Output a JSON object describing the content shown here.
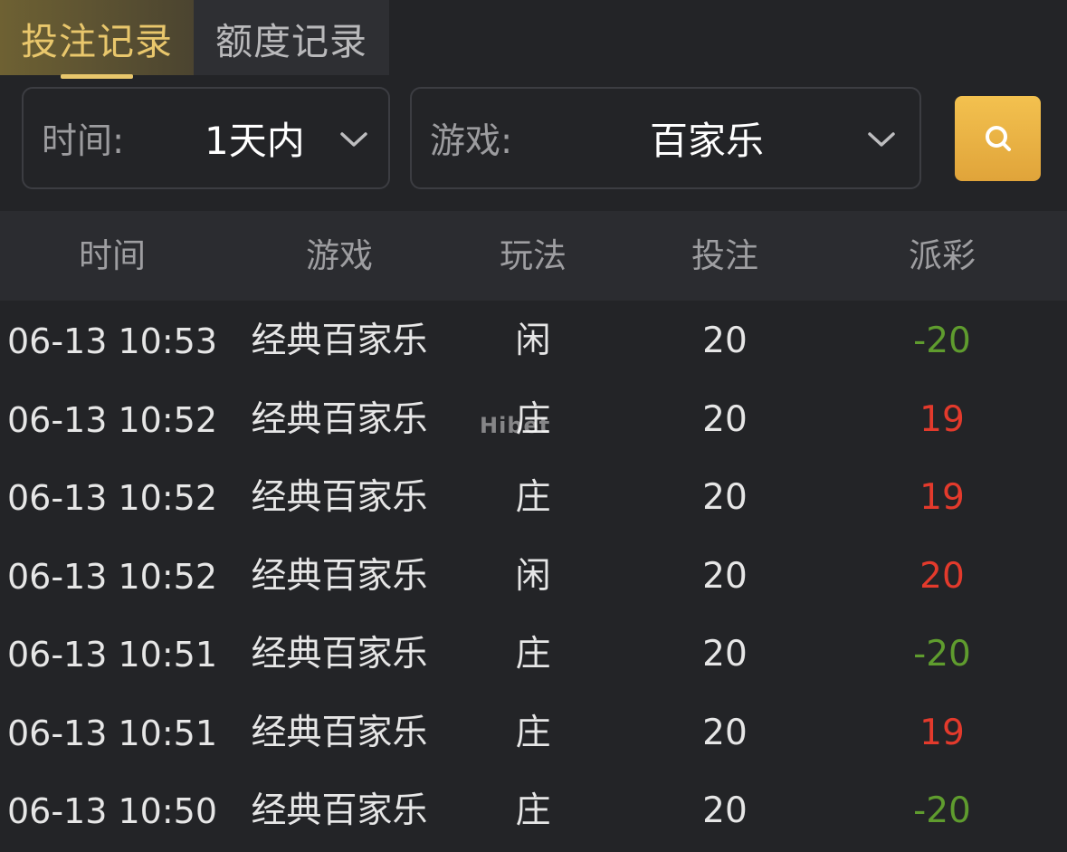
{
  "tabs": [
    {
      "label": "投注记录",
      "active": true
    },
    {
      "label": "额度记录",
      "active": false
    }
  ],
  "filters": {
    "time": {
      "label": "时间:",
      "value": "1天内",
      "icon": "chevron-down-icon"
    },
    "game": {
      "label": "游戏:",
      "value": "百家乐",
      "icon": "chevron-down-icon"
    }
  },
  "search_button": {
    "icon": "search-icon",
    "color": "#eab444"
  },
  "table": {
    "headers": [
      "时间",
      "游戏",
      "玩法",
      "投注",
      "派彩"
    ],
    "rows": [
      {
        "time": "06-13 10:53",
        "game": "经典百家乐",
        "play": "闲",
        "bet": "20",
        "payout": "-20",
        "result": "lose"
      },
      {
        "time": "06-13 10:52",
        "game": "经典百家乐",
        "play": "庄",
        "bet": "20",
        "payout": "19",
        "result": "win"
      },
      {
        "time": "06-13 10:52",
        "game": "经典百家乐",
        "play": "庄",
        "bet": "20",
        "payout": "19",
        "result": "win"
      },
      {
        "time": "06-13 10:52",
        "game": "经典百家乐",
        "play": "闲",
        "bet": "20",
        "payout": "20",
        "result": "win"
      },
      {
        "time": "06-13 10:51",
        "game": "经典百家乐",
        "play": "庄",
        "bet": "20",
        "payout": "-20",
        "result": "lose"
      },
      {
        "time": "06-13 10:51",
        "game": "经典百家乐",
        "play": "庄",
        "bet": "20",
        "payout": "19",
        "result": "win"
      },
      {
        "time": "06-13 10:50",
        "game": "经典百家乐",
        "play": "庄",
        "bet": "20",
        "payout": "-20",
        "result": "lose"
      }
    ]
  },
  "colors": {
    "accent": "#e9c76c",
    "win": "#e33a2c",
    "lose": "#5f9c2e",
    "background": "#232427"
  },
  "watermark": "Hibet"
}
